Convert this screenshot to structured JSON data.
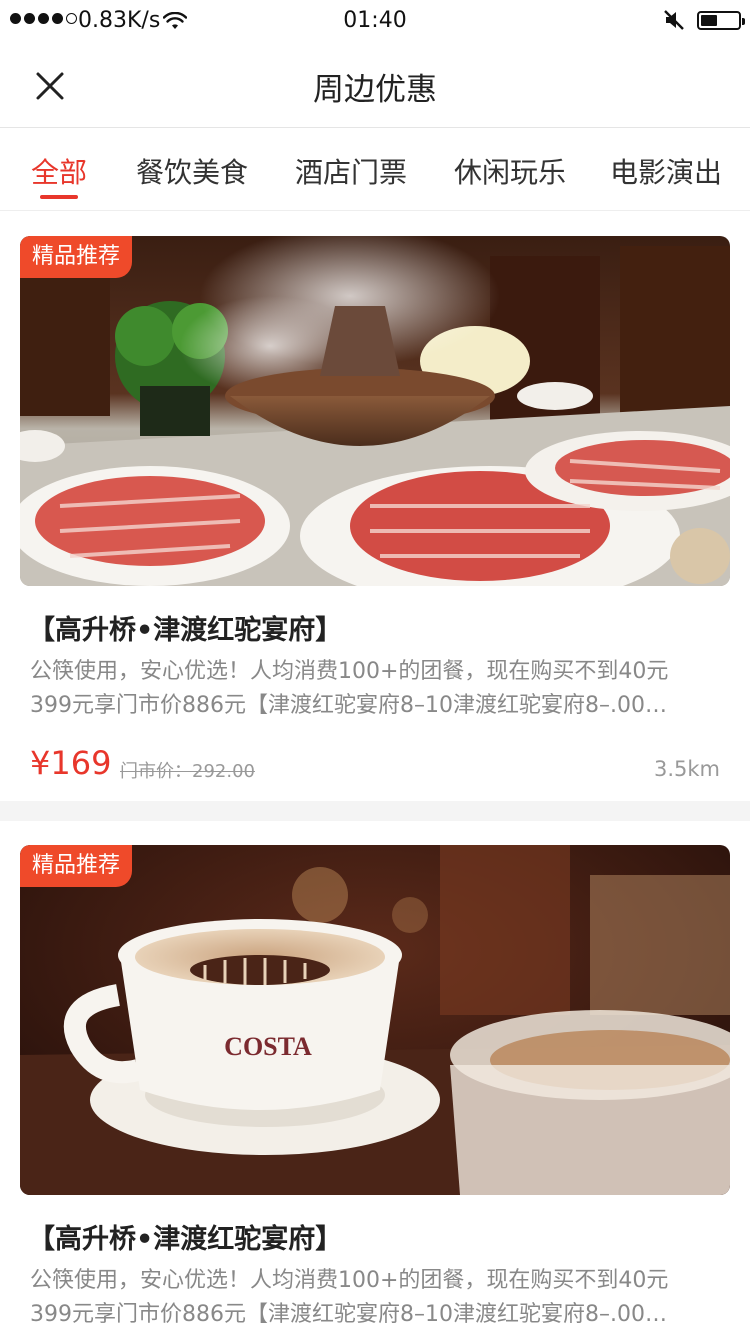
{
  "status_bar": {
    "net_speed": "0.83K/s",
    "time": "01:40",
    "battery_level": 0.45
  },
  "nav": {
    "title": "周边优惠"
  },
  "tabs": [
    {
      "label": "全部"
    },
    {
      "label": "餐饮美食"
    },
    {
      "label": "酒店门票"
    },
    {
      "label": "休闲玩乐"
    },
    {
      "label": "电影演出"
    }
  ],
  "deals": [
    {
      "badge": "精品推荐",
      "title": "【高升桥•津渡红驼宴府】",
      "desc_line1": "公筷使用，安心优选！人均消费100+的团餐，现在购买不到40元",
      "desc_line2": "399元享门市价886元【津渡红驼宴府8–10津渡红驼宴府8–.00…",
      "price": "¥169",
      "original_price": "门市价：292.00",
      "distance": "3.5km",
      "image": "hotpot-photo"
    },
    {
      "badge": "精品推荐",
      "title": "【高升桥•津渡红驼宴府】",
      "desc_line1": "公筷使用，安心优选！人均消费100+的团餐，现在购买不到40元",
      "desc_line2": "399元享门市价886元【津渡红驼宴府8–10津渡红驼宴府8–.00…",
      "image": "coffee-photo",
      "cup_brand": "COSTA"
    }
  ],
  "colors": {
    "accent": "#e8362b",
    "badge": "#ef4a2a"
  }
}
